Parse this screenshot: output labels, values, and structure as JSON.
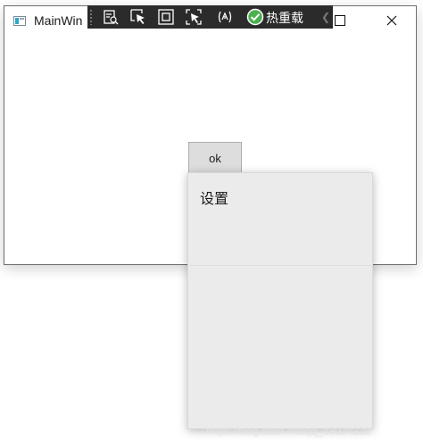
{
  "window": {
    "title": "MainWin",
    "icon": "app-window-icon"
  },
  "toolbar": {
    "icons": [
      "live-visual-tree-icon",
      "select-element-icon",
      "display-layout-adorners-icon",
      "track-focus-icon",
      "binding-failures-icon"
    ],
    "hot_reload_label": "热重载",
    "hot_reload_icon": "check-circle-icon",
    "hot_reload_color": "#4caf50",
    "collapse_icon": "chevron-left-icon"
  },
  "main": {
    "ok_button_label": "ok"
  },
  "popup": {
    "items": [
      {
        "label": "设置"
      }
    ]
  },
  "watermark": "https://blog.csdn.net/qq_43024228"
}
